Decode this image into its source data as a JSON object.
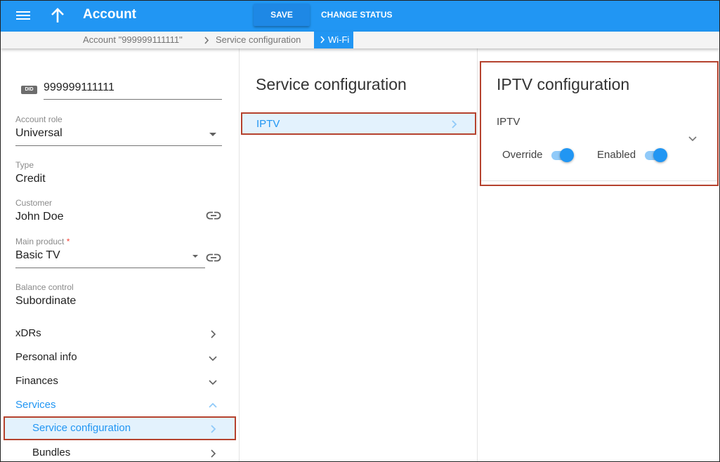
{
  "header": {
    "title": "Account",
    "save_label": "SAVE",
    "change_status_label": "CHANGE STATUS",
    "menu_icon": "menu-icon",
    "up_icon": "arrow-up-icon"
  },
  "breadcrumb": {
    "items": [
      "Account \"999999111111\"",
      "Service configuration"
    ],
    "active": "Wi-Fi",
    "separator": ">"
  },
  "left_panel": {
    "did": {
      "badge": "DID",
      "value": "999999111111"
    },
    "fields": {
      "account_role": {
        "label": "Account role",
        "value": "Universal"
      },
      "type": {
        "label": "Type",
        "value": "Credit"
      },
      "customer": {
        "label": "Customer",
        "value": "John Doe"
      },
      "main_product": {
        "label": "Main product",
        "required_mark": "*",
        "value": "Basic TV"
      },
      "balance_control": {
        "label": "Balance control",
        "value": "Subordinate"
      }
    },
    "nav": [
      {
        "label": "xDRs",
        "icon": "chevron-right-icon"
      },
      {
        "label": "Personal info",
        "icon": "chevron-down-icon"
      },
      {
        "label": "Finances",
        "icon": "chevron-down-icon"
      },
      {
        "label": "Services",
        "icon": "chevron-up-icon",
        "expanded": true
      },
      {
        "label": "Service configuration",
        "icon": "chevron-right-icon",
        "selected": true
      },
      {
        "label": "Bundles",
        "icon": "chevron-right-icon"
      }
    ]
  },
  "middle_panel": {
    "title": "Service configuration",
    "items": [
      {
        "label": "IPTV",
        "selected": true
      }
    ]
  },
  "right_panel": {
    "title": "IPTV configuration",
    "section_label": "IPTV",
    "override": {
      "label": "Override",
      "on": true
    },
    "enabled": {
      "label": "Enabled",
      "on": true
    }
  },
  "colors": {
    "primary": "#2196f3",
    "highlight_border": "#b5422e",
    "selected_bg": "#e3f2fd"
  }
}
